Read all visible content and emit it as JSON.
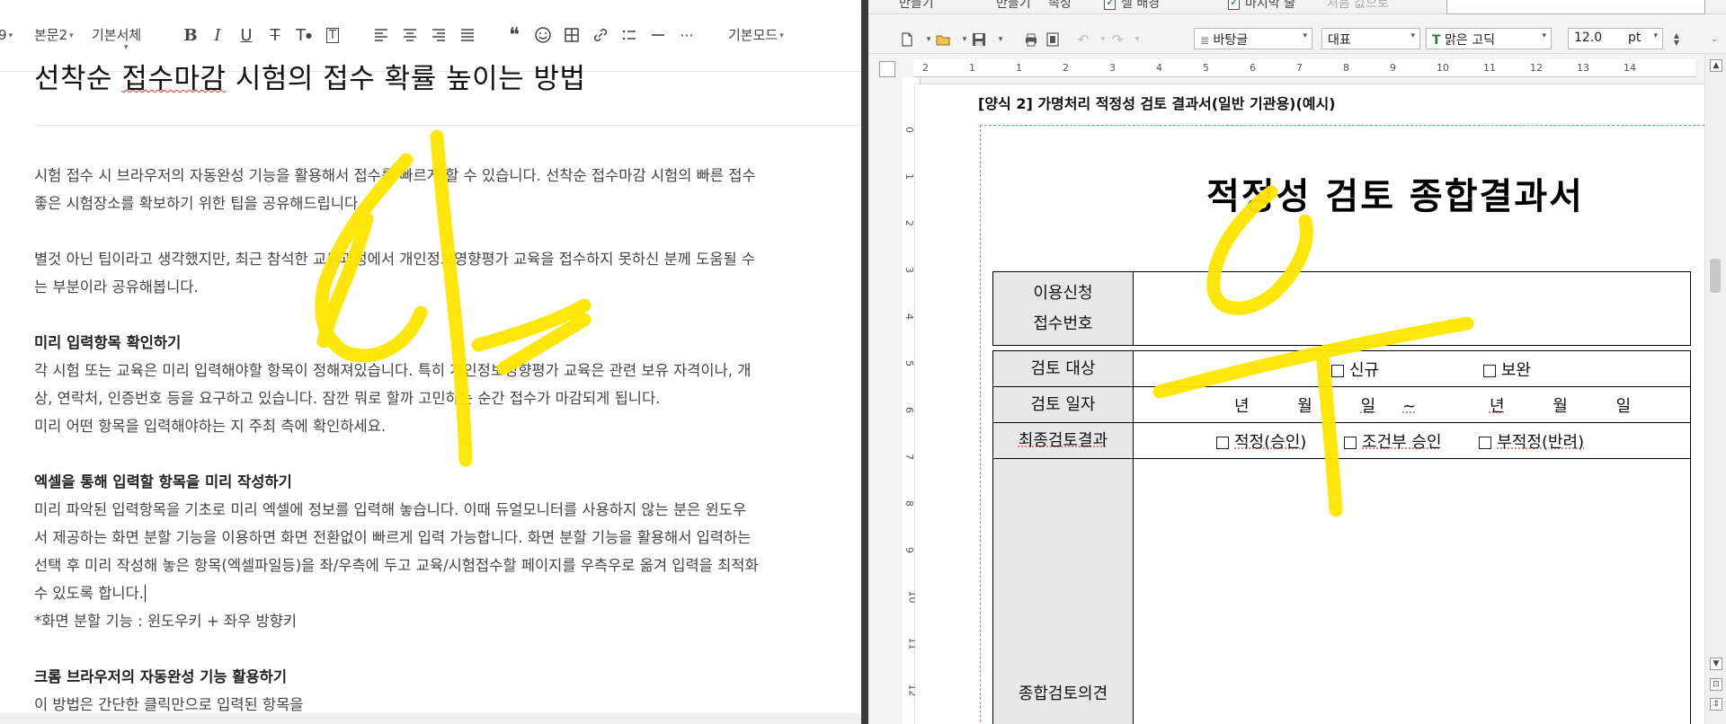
{
  "left": {
    "toolbar": {
      "style": "본문2",
      "font": "기본서체",
      "mode": "기본모드"
    },
    "title_part1": "선착순 ",
    "title_squig": "접수마감",
    "title_part2": " 시험의 접수 확률 높이는 방법",
    "lines": [
      "시험 접수 시 브라우저의 자동완성 기능을 활용해서 접수를 빠르게 할 수 있습니다. 선착순 접수마감 시험의 빠른 접수",
      "좋은 시험장소를 확보하기 위한 팁을 공유해드립니다.",
      "별것 아닌 팁이라고 생각했지만, 최근 참석한 교육과정에서 개인정보영향평가 교육을 접수하지 못하신 분께 도움될 수",
      "는 부분이라 공유해봅니다.",
      "미리 입력항목 확인하기",
      "각 시험 또는 교육은 미리 입력해야할 항목이 정해져있습니다. 특히 개인정보영향평가 교육은 관련 보유 자격이나, 개",
      "상, 연락처, 인증번호 등을 요구하고 있습니다. 잠깐 뭐로 할까 고민하는 순간 접수가 마감되게 됩니다.",
      "미리 어떤 항목을 입력해야하는 지 주최 측에 확인하세요.",
      "엑셀을 통해 입력할 항목을 미리 작성하기",
      "미리 파악된 입력항목을 기초로 미리 엑셀에 정보를 입력해 놓습니다. 이때 듀얼모니터를 사용하지 않는 분은 윈도우",
      "서 제공하는 화면 분할 기능을 이용하면 화면 전환없이 빠르게 입력 가능합니다. 화면 분할 기능을 활용해서 입력하는",
      "선택 후 미리 작성해 놓은 항목(엑셀파일등)을 좌/우측에 두고 교육/시험접수할 페이지를 우측우로 옮겨 입력을 최적화",
      "수 있도록 합니다.",
      "*화면 분할 기능 : 윈도우키 + 좌우 방향키",
      "크롬 브라우저의 자동완성 기능 활용하기",
      "이 방법은 간단한 클릭만으로 입력된 항목을"
    ]
  },
  "right": {
    "ribbon": {
      "item1": "만들기",
      "item2": "만들기",
      "item3": "속성",
      "item4": "셀 배경",
      "item5": "마지막 줄",
      "item6": "처음 값으로"
    },
    "toolbar": {
      "style": "바탕글",
      "para": "대표",
      "font": "맑은 고딕",
      "size": "12.0",
      "unit": "pt"
    },
    "ruler_h": [
      "2",
      "1",
      "1",
      "2",
      "3",
      "4",
      "5",
      "6",
      "7",
      "8",
      "9",
      "10",
      "11",
      "12",
      "13",
      "14"
    ],
    "ruler_v": [
      "0",
      "1",
      "2",
      "3",
      "4",
      "5",
      "6",
      "7",
      "8",
      "9",
      "10",
      "11",
      "12"
    ],
    "form_label": "[양식 2] 가명처리 적정성 검토 결과서(일반 기관용)(예시)",
    "doc_title": "적정성 검토 종합결과서",
    "rows": {
      "receipt_l1": "이용신청",
      "receipt_l2": "접수번호",
      "target_label": "검토 대상",
      "target_opt1": "신규",
      "target_opt2": "보완",
      "date_label": "검토 일자",
      "date_y1": "년",
      "date_m1": "월",
      "date_d1": "일",
      "date_sep": "~",
      "date_y2": "년",
      "date_m2": "월",
      "date_d2": "일",
      "result_label": "최종검토결과",
      "result_opt1": "적정(승인)",
      "result_opt2": "조건부 승인",
      "result_opt3": "부적정(반려)",
      "opinion_label": "종합검토의견"
    }
  },
  "colors": {
    "highlighter": "#ffe600",
    "splitter": "#3a3a3a",
    "label_cell": "#e8e8e8"
  }
}
